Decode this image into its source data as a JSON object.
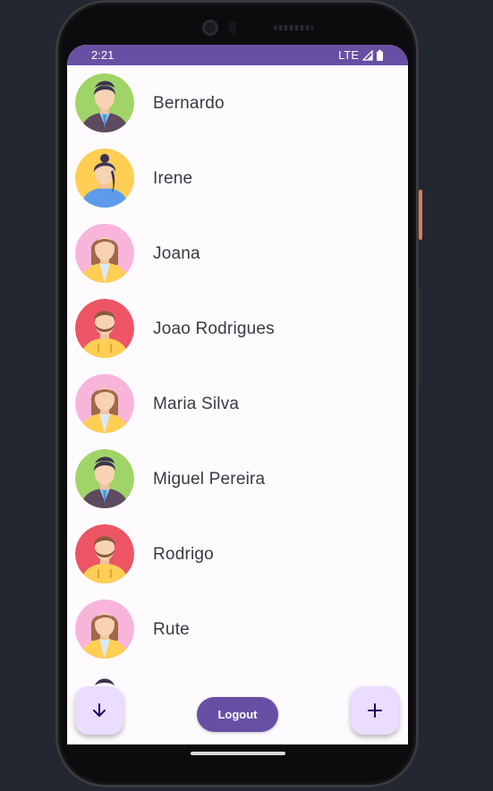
{
  "status_bar": {
    "time": "2:21",
    "network": "LTE",
    "color": "#6750a4"
  },
  "contacts": [
    {
      "name": "Bernardo",
      "avatar": "man-green-avatar-icon"
    },
    {
      "name": "Irene",
      "avatar": "woman-bun-yellow-avatar-icon"
    },
    {
      "name": "Joana",
      "avatar": "woman-pink-avatar-icon"
    },
    {
      "name": "Joao Rodrigues",
      "avatar": "man-beard-red-avatar-icon"
    },
    {
      "name": "Maria Silva",
      "avatar": "woman-pink-avatar-icon"
    },
    {
      "name": "Miguel Pereira",
      "avatar": "man-green-avatar-icon"
    },
    {
      "name": "Rodrigo",
      "avatar": "man-beard-red-avatar-icon"
    },
    {
      "name": "Rute",
      "avatar": "woman-pink-avatar-icon"
    }
  ],
  "actions": {
    "scroll_down_icon": "arrow-down-icon",
    "add_icon": "plus-icon",
    "logout_label": "Logout"
  },
  "colors": {
    "primary": "#6750a4",
    "fab_container": "#eaddff",
    "background": "#fefbfe"
  }
}
